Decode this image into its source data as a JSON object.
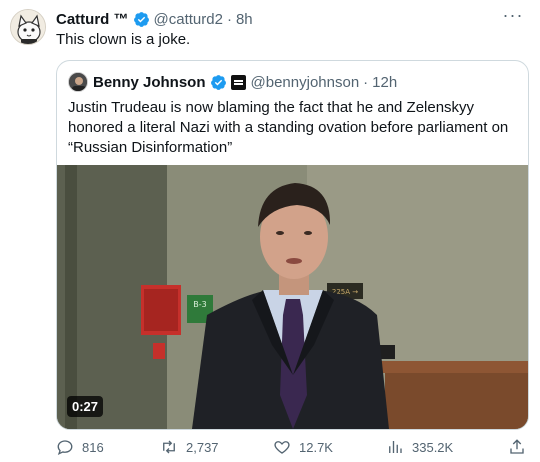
{
  "tweet": {
    "author_name": "Catturd ™",
    "handle": "@catturd2",
    "separator": "·",
    "time": "8h",
    "more_label": "···",
    "text": "This clown is a joke."
  },
  "quote": {
    "author_name": "Benny Johnson",
    "handle": "@bennyjohnson",
    "separator": "·",
    "time": "12h",
    "text": "Justin Trudeau is now blaming the fact that he and Zelenskyy honored a literal Nazi with a standing ovation before parliament on “Russian Disinformation”",
    "media": {
      "duration": "0:27",
      "sign_text": "B-3",
      "exit_sign_text": "225A →"
    }
  },
  "actions": {
    "replies": "816",
    "retweets": "2,737",
    "likes": "12.7K",
    "views": "335.2K"
  },
  "colors": {
    "verified_blue": "#1d9bf0",
    "muted_text": "#536471",
    "border": "#cfd9de"
  }
}
